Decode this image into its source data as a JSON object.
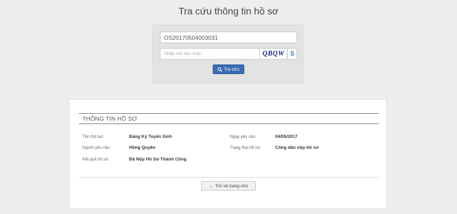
{
  "page": {
    "title": "Tra cứu thông tin hồ sơ"
  },
  "search": {
    "code_value": "OS20170504003031",
    "captcha_placeholder": "Nhập mã xác nhận",
    "captcha_text": "QBQW",
    "refresh_symbol": "S",
    "button_label": "Tra cứu",
    "button_color": "#3b6db4"
  },
  "info": {
    "section_title": "THÔNG TIN HỒ SƠ",
    "fields": [
      {
        "label": "Tên thủ tục:",
        "value": "Đăng Ký Tuyển Sinh"
      },
      {
        "label": "Người yêu cầu:",
        "value": "Hồng Quyên"
      },
      {
        "label": "Kết quả hồ sơ:",
        "value": "Đã Nộp Hồ Sơ Thành Công"
      },
      {
        "label": "Ngày yêu cầu:",
        "value": "04/05/2017"
      },
      {
        "label": "Trạng thái hồ sơ:",
        "value": "Công dân nộp hồ sơ"
      }
    ],
    "back_arrow": "←",
    "back_label": "Trở về trang chủ"
  },
  "icons": {
    "search": "search-icon",
    "refresh": "refresh-icon",
    "back": "arrow-left-icon"
  }
}
